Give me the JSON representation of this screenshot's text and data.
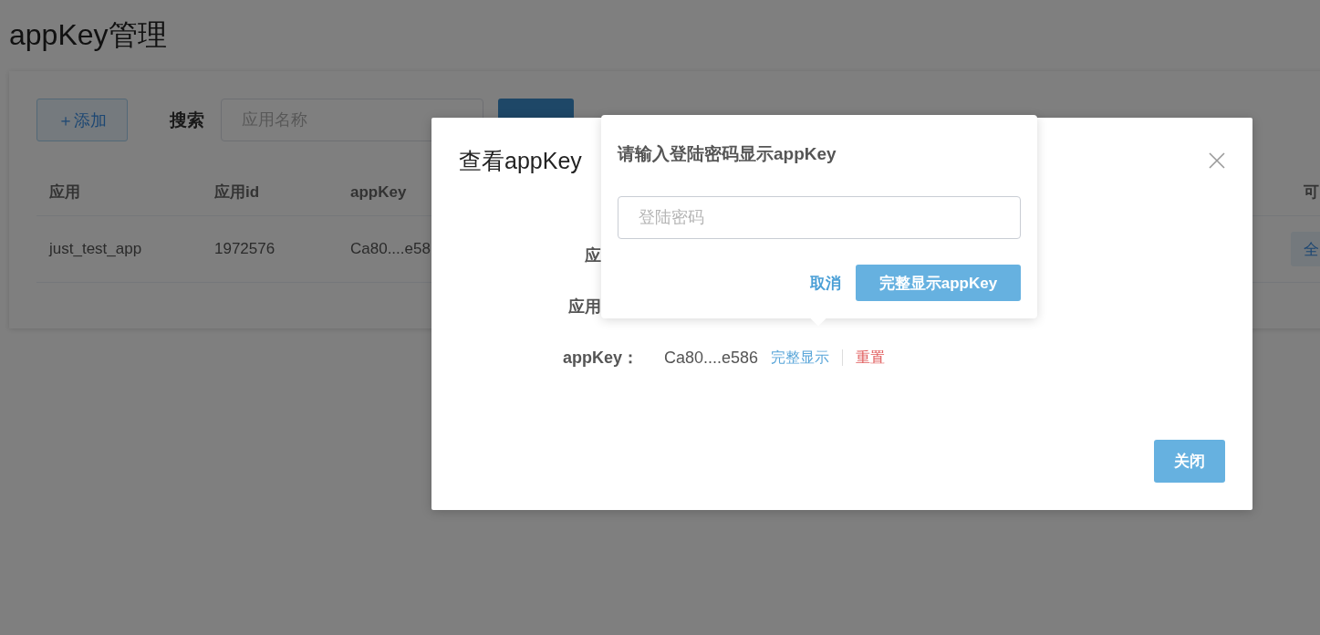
{
  "page_title": "appKey管理",
  "toolbar": {
    "add_button": "＋添加",
    "search_label": "搜索",
    "search_field": {
      "placeholder": "应用名称"
    }
  },
  "table": {
    "columns": [
      "应用",
      "应用id",
      "appKey",
      "可"
    ],
    "rows": [
      {
        "cells": [
          "just_test_app",
          "1972576",
          "Ca80....e58"
        ],
        "action": "全"
      }
    ]
  },
  "dialog": {
    "title": "查看appKey",
    "fields": [
      {
        "kind": "cut",
        "label": "应"
      },
      {
        "kind": "cut",
        "label": "应用"
      },
      {
        "kind": "full",
        "label": "appKey：",
        "value": "Ca80....e586",
        "links": [
          {
            "kind": "primary",
            "text": "完整显示"
          },
          {
            "kind": "danger",
            "text": "重置"
          }
        ]
      }
    ],
    "close_button": "关闭"
  },
  "popover": {
    "title": "请输入登陆密码显示appKey",
    "password_field": {
      "placeholder": "登陆密码"
    },
    "cancel": "取消",
    "confirm": "完整显示appKey"
  }
}
